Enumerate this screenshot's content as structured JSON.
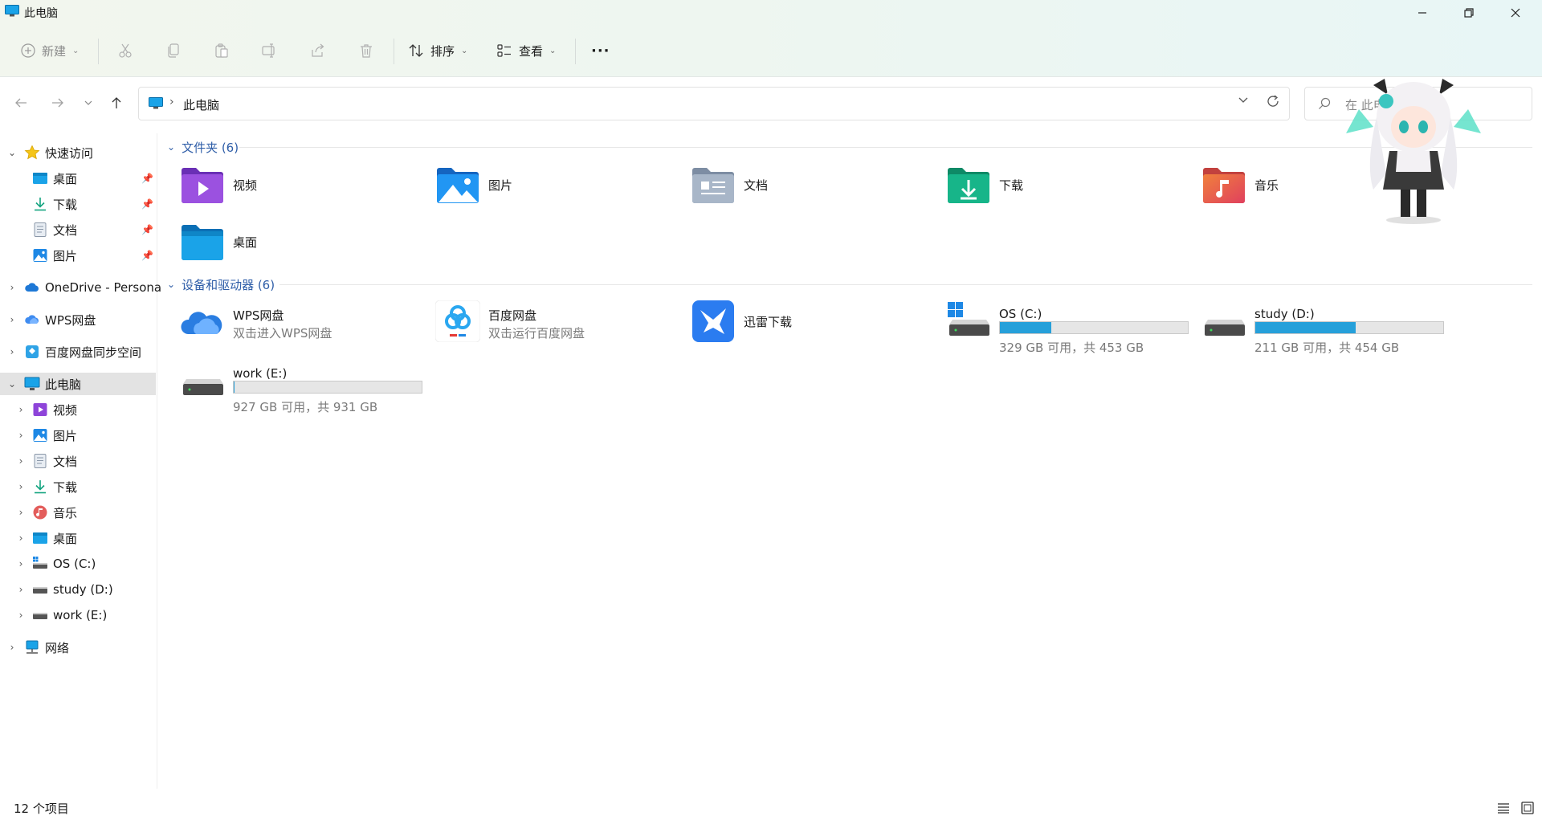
{
  "window": {
    "title": "此电脑",
    "controls": [
      "minimize",
      "maximize",
      "close"
    ]
  },
  "toolbar": {
    "new_label": "新建",
    "sort_label": "排序",
    "view_label": "查看",
    "more_label": "···"
  },
  "address": {
    "path": "此电脑",
    "chevron": "›"
  },
  "search": {
    "placeholder": "在 此电"
  },
  "sidebar": {
    "quick_access": "快速访问",
    "quick_items": [
      "桌面",
      "下载",
      "文档",
      "图片"
    ],
    "onedrive": "OneDrive - Persona",
    "wps": "WPS网盘",
    "baidu_sync": "百度网盘同步空间",
    "this_pc": "此电脑",
    "pc_items": [
      "视频",
      "图片",
      "文档",
      "下载",
      "音乐",
      "桌面",
      "OS (C:)",
      "study (D:)",
      "work (E:)"
    ],
    "network": "网络"
  },
  "content": {
    "folders_header": "文件夹 (6)",
    "folders": [
      "视频",
      "图片",
      "文档",
      "下载",
      "音乐",
      "桌面"
    ],
    "devices_header": "设备和驱动器 (6)",
    "apps": [
      {
        "name": "WPS网盘",
        "sub": "双击进入WPS网盘"
      },
      {
        "name": "百度网盘",
        "sub": "双击运行百度网盘"
      },
      {
        "name": "迅雷下载",
        "sub": ""
      }
    ],
    "drives": [
      {
        "name": "OS (C:)",
        "info": "329 GB 可用，共 453 GB",
        "used_fraction": 0.274
      },
      {
        "name": "study (D:)",
        "info": "211 GB 可用，共 454 GB",
        "used_fraction": 0.535
      },
      {
        "name": "work (E:)",
        "info": "927 GB 可用，共 931 GB",
        "used_fraction": 0.004
      }
    ]
  },
  "status": {
    "count": "12 个项目"
  },
  "colors": {
    "accent": "#2f5ea8",
    "drive_fill": "#26a0da",
    "selected_bg": "#e3e3e3"
  }
}
